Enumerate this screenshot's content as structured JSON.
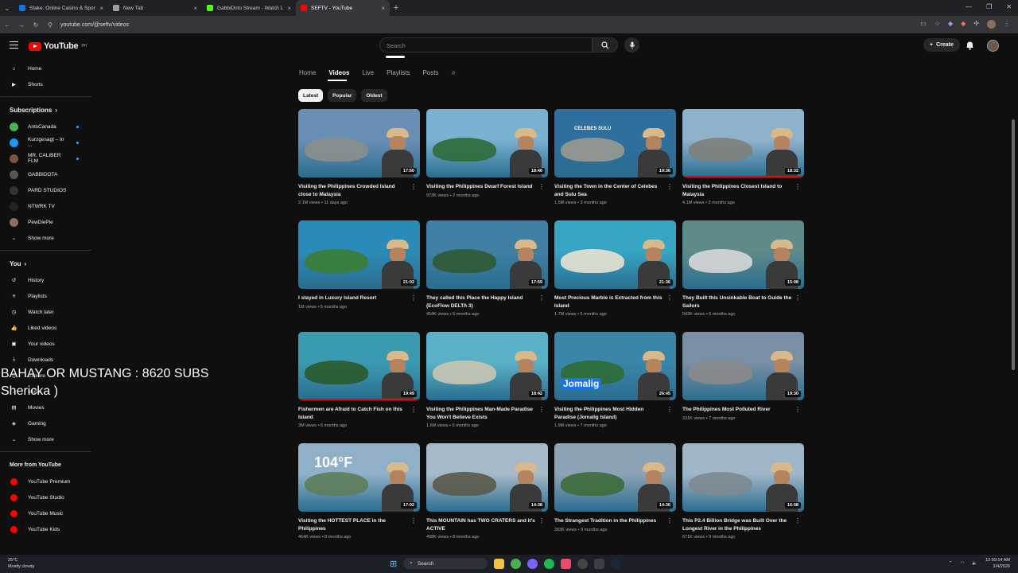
{
  "browser": {
    "tabs": [
      {
        "title": "Stake: Online Casino & Sports",
        "color": "#1475e1",
        "active": false
      },
      {
        "title": "New Tab",
        "color": "#9aa0a6",
        "active": false
      },
      {
        "title": "GabbiDoto Stream - Watch Liv",
        "color": "#53fc18",
        "active": false
      },
      {
        "title": "SEFTV - YouTube",
        "color": "#ff0000",
        "active": true
      }
    ],
    "url": "youtube.com/@seftv/videos"
  },
  "header": {
    "logo_text": "YouTube",
    "logo_region": "PH",
    "search_placeholder": "Search",
    "create_label": "Create"
  },
  "sidebar": {
    "main": [
      {
        "label": "Home",
        "icon": "home-icon"
      },
      {
        "label": "Shorts",
        "icon": "shorts-icon"
      }
    ],
    "subscriptions_title": "Subscriptions",
    "subscriptions": [
      {
        "label": "AntsCanada",
        "color": "#4caf50",
        "dot": true
      },
      {
        "label": "Kurzgesagt – In ...",
        "color": "#2196f3",
        "dot": true
      },
      {
        "label": "MR. CALIBER FLM",
        "color": "#795548",
        "dot": true
      },
      {
        "label": "GABBIDOTA",
        "color": "#555555",
        "dot": false
      },
      {
        "label": "PARD STUDIOS",
        "color": "#333333",
        "dot": false
      },
      {
        "label": "NTWRK TV",
        "color": "#222222",
        "dot": false
      },
      {
        "label": "PewDiePie",
        "color": "#8d6e63",
        "dot": false
      }
    ],
    "show_more": "Show more",
    "you_title": "You",
    "you_items": [
      {
        "label": "History",
        "icon": "history-icon"
      },
      {
        "label": "Playlists",
        "icon": "playlists-icon"
      },
      {
        "label": "Watch later",
        "icon": "clock-icon"
      },
      {
        "label": "Liked videos",
        "icon": "thumbs-up-icon"
      },
      {
        "label": "Your videos",
        "icon": "your-videos-icon"
      },
      {
        "label": "Downloads",
        "icon": "download-icon"
      }
    ],
    "explore_items": [
      {
        "label": "Explore",
        "icon": "explore-icon"
      },
      {
        "label": "Music",
        "icon": "music-icon"
      },
      {
        "label": "Movies",
        "icon": "movies-icon"
      },
      {
        "label": "Gaming",
        "icon": "gaming-icon"
      }
    ],
    "show_more_2": "Show more",
    "more_title": "More from YouTube",
    "more_items": [
      {
        "label": "YouTube Premium"
      },
      {
        "label": "YouTube Studio"
      },
      {
        "label": "YouTube Music"
      },
      {
        "label": "YouTube Kids"
      }
    ]
  },
  "overlay_text": {
    "line1": "BAHAY OR MUSTANG : 8620 SUBS",
    "line2": "Shericka )"
  },
  "channel_tabs": [
    "Home",
    "Videos",
    "Live",
    "Playlists",
    "Posts"
  ],
  "active_tab": "Videos",
  "chips": [
    "Latest",
    "Popular",
    "Oldest"
  ],
  "videos": [
    {
      "title": "Visiting the Philippines Crowded Island close to Malaysia",
      "meta": "2.1M views • 11 days ago",
      "duration": "17:50",
      "bg": "#6a8fb5",
      "land": "#8a8f8c",
      "watched": 0
    },
    {
      "title": "Visiting the Philippines Dwarf Forest Island",
      "meta": "973K views • 2 months ago",
      "duration": "18:46",
      "bg": "#7ab0d0",
      "land": "#2f6b3a",
      "watched": 0
    },
    {
      "title": "Visiting the Town in the Center of Celebes and Sulu Sea",
      "meta": "1.5M views • 3 months ago",
      "duration": "19:36",
      "bg": "#2e6fa0",
      "land": "#9a9a90",
      "watched": 0,
      "ovtext": "CELEBES   SULU"
    },
    {
      "title": "Visiting the Philippines Closest Island to Malaysia",
      "meta": "4.1M views • 3 months ago",
      "duration": "18:32",
      "bg": "#8fb2cc",
      "land": "#7d7f7a",
      "watched": 100
    },
    {
      "title": "I stayed in Luxury Island Resort",
      "meta": "1M views • 5 months ago",
      "duration": "21:02",
      "bg": "#2b8bb8",
      "land": "#3c7d35",
      "watched": 0
    },
    {
      "title": "They called this Place the Happy Island (EcoFlow DELTA 3)",
      "meta": "454K views • 5 months ago",
      "duration": "17:59",
      "bg": "#3f7fa3",
      "land": "#2f5a33",
      "watched": 0
    },
    {
      "title": "Most Precious Marble is Extracted from this Island",
      "meta": "1.7M views • 6 months ago",
      "duration": "21:36",
      "bg": "#36a6c4",
      "land": "#e8e2cf",
      "watched": 0
    },
    {
      "title": "They Built this Unsinkable Boat to Guide the Sailors",
      "meta": "543K views • 6 months ago",
      "duration": "15:08",
      "bg": "#5f8a8a",
      "land": "#d7d7d7",
      "watched": 0
    },
    {
      "title": "Fishermen are Afraid to Catch Fish on this Island",
      "meta": "3M views • 6 months ago",
      "duration": "19:49",
      "bg": "#3a9bb0",
      "land": "#2a5a2c",
      "watched": 100
    },
    {
      "title": "Visiting the Philippines Man-Made Paradise You Won't Believe Exists",
      "meta": "1.6M views • 6 months ago",
      "duration": "18:42",
      "bg": "#5ab1c7",
      "land": "#c9c5b0",
      "watched": 0
    },
    {
      "title": "Visiting the Philippines Most Hidden Paradise (Jomalig Island)",
      "meta": "1.9M views • 7 months ago",
      "duration": "26:45",
      "bg": "#3a86a8",
      "land": "#2d6b34",
      "watched": 0,
      "ovtext": "Jomalig"
    },
    {
      "title": "The Philippines Most Polluted River",
      "meta": "331K views • 7 months ago",
      "duration": "19:30",
      "bg": "#7a8fa3",
      "land": "#8a8a8a",
      "watched": 0
    },
    {
      "title": "Visiting the HOTTEST PLACE in the Philippines",
      "meta": "464K views • 8 months ago",
      "duration": "17:02",
      "bg": "#8fb0c8",
      "land": "#5e7d5a",
      "watched": 0,
      "ovtext": "104°F"
    },
    {
      "title": "This MOUNTAIN has TWO CRATERS and it's ACTIVE",
      "meta": "498K views • 8 months ago",
      "duration": "14:38",
      "bg": "#a6b9c8",
      "land": "#5a5a4a",
      "watched": 0
    },
    {
      "title": "The Strangest Tradition in the Philippines",
      "meta": "283K views • 9 months ago",
      "duration": "14:36",
      "bg": "#8ba3b5",
      "land": "#3f6b3a",
      "watched": 0
    },
    {
      "title": "This P2.4 Billion Bridge was Built Over the Longest River in the Philippines",
      "meta": "671K views • 9 months ago",
      "duration": "16:08",
      "bg": "#9fb6c8",
      "land": "#7d8a90",
      "watched": 0
    }
  ],
  "taskbar": {
    "temp": "25°C",
    "weather": "Mostly cloudy",
    "search": "Search",
    "time": "12:59:14 AM",
    "date": "2/4/2026"
  }
}
